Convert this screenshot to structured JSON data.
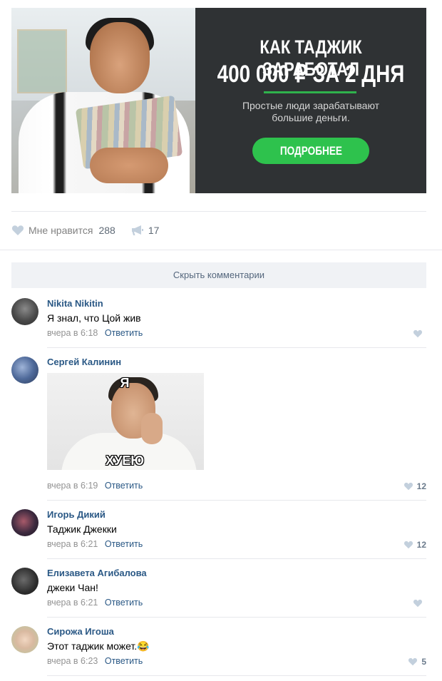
{
  "ad": {
    "title_line1": "КАК ТАДЖИК ЗАРАБОТАЛ",
    "title_line2": "400 000 ₽ ЗА 2 ДНЯ",
    "subtitle_line1": "Простые люди зарабатывают",
    "subtitle_line2": "большие деньги.",
    "button_label": "ПОДРОБНЕЕ",
    "accent_color": "#2ec24d"
  },
  "post_actions": {
    "like_label": "Мне нравится",
    "like_count": "288",
    "share_count": "17",
    "like_icon": "heart-icon",
    "share_icon": "megaphone-icon"
  },
  "hide_comments_label": "Скрыть комментарии",
  "comments": [
    {
      "author": "Nikita Nikitin",
      "text": "Я знал, что Цой жив",
      "time": "вчера в 6:18",
      "reply": "Ответить",
      "likes": ""
    },
    {
      "author": "Сергей Калинин",
      "text": "",
      "time": "вчера в 6:19",
      "reply": "Ответить",
      "likes": "12",
      "meme": {
        "top": "Я",
        "bottom": "ХУЕЮ"
      }
    },
    {
      "author": "Игорь Дикий",
      "text": "Таджик Джекки",
      "time": "вчера в 6:21",
      "reply": "Ответить",
      "likes": "12"
    },
    {
      "author": "Елизавета Агибалова",
      "text": "джеки Чан!",
      "time": "вчера в 6:21",
      "reply": "Ответить",
      "likes": ""
    },
    {
      "author": "Сирожа Игоша",
      "text": "Этот таджик может.😂",
      "time": "вчера в 6:23",
      "reply": "Ответить",
      "likes": "5"
    }
  ],
  "colors": {
    "link": "#2a5885",
    "meta": "#939393",
    "divider": "#e7e8ec"
  }
}
